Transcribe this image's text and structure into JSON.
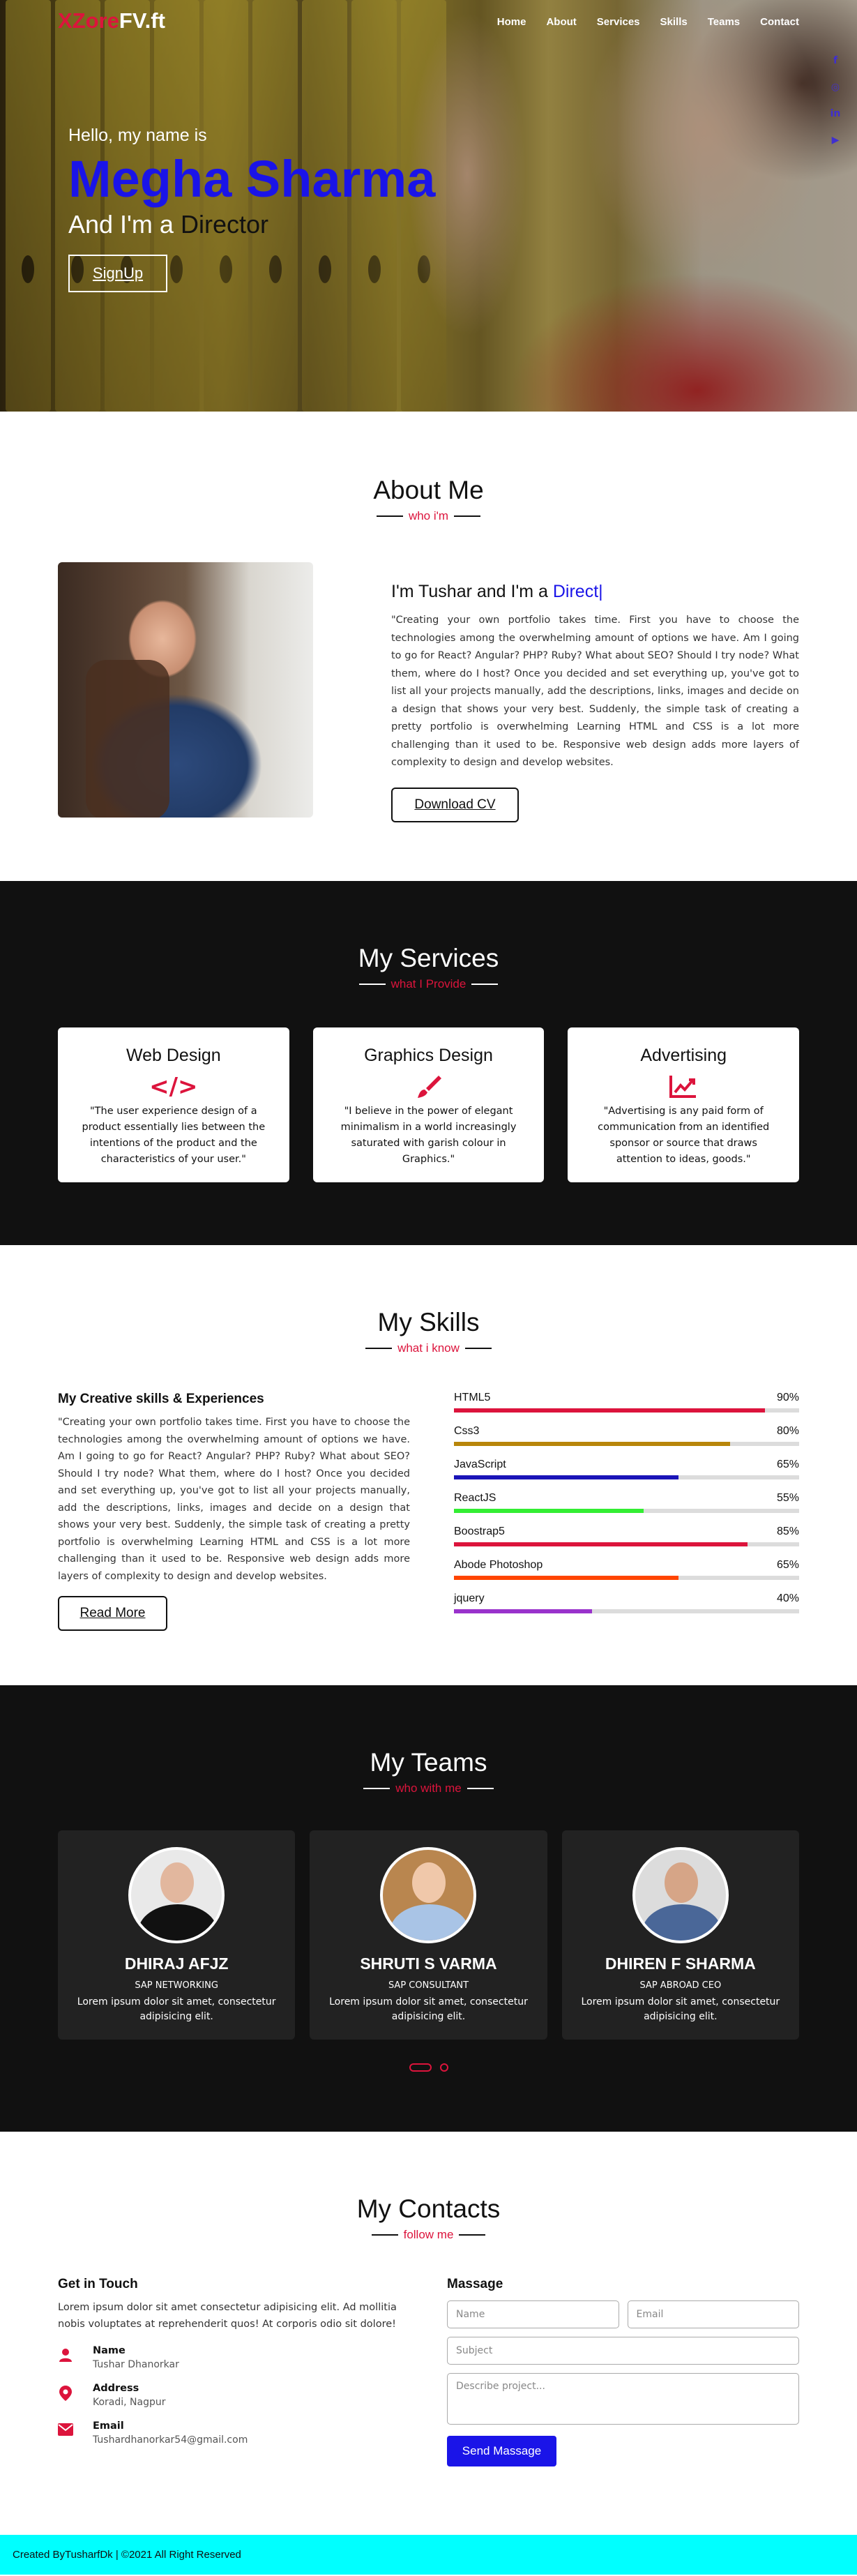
{
  "nav": {
    "logo_part1": "XZore",
    "logo_part2": "FV.ft",
    "items": [
      {
        "label": "Home"
      },
      {
        "label": "About"
      },
      {
        "label": "Services"
      },
      {
        "label": "Skills"
      },
      {
        "label": "Teams"
      },
      {
        "label": "Contact"
      }
    ]
  },
  "socials": [
    "facebook-icon",
    "instagram-icon",
    "linkedin-icon",
    "youtube-icon"
  ],
  "hero": {
    "greeting": "Hello, my name is",
    "name": "Megha Sharma",
    "role_prefix": "And I'm a ",
    "role": "Director",
    "signup_label": "SignUp"
  },
  "about": {
    "title": "About Me",
    "subtitle": "who i'm",
    "heading_prefix": "I'm Tushar and I'm a ",
    "heading_typed": "Direct|",
    "text": "\"Creating your own portfolio takes time. First you have to choose the technologies among the overwhelming amount of options we have. Am I going to go for React? Angular? PHP? Ruby? What about SEO? Should I try node? What them, where do I host? Once you decided and set everything up, you've got to list all your projects manually, add the descriptions, links, images and decide on a design that shows your very best. Suddenly, the simple task of creating a pretty portfolio is overwhelming Learning HTML and CSS is a lot more challenging than it used to be. Responsive web design adds more layers of complexity to design and develop websites.",
    "button": "Download CV"
  },
  "services": {
    "title": "My Services",
    "subtitle": "what I Provide",
    "cards": [
      {
        "title": "Web Design",
        "icon": "code-icon",
        "text": "\"The user experience design of a product essentially lies between the intentions of the product and the characteristics of your user.\""
      },
      {
        "title": "Graphics Design",
        "icon": "paint-brush-icon",
        "text": "\"I believe in the power of elegant minimalism in a world increasingly saturated with garish colour in Graphics.\""
      },
      {
        "title": "Advertising",
        "icon": "chart-line-icon",
        "text": "\"Advertising is any paid form of communication from an identified sponsor or source that draws attention to ideas, goods.\""
      }
    ]
  },
  "skills": {
    "title": "My Skills",
    "subtitle": "what i know",
    "heading": "My Creative skills & Experiences",
    "text": "\"Creating your own portfolio takes time. First you have to choose the technologies among the overwhelming amount of options we have. Am I going to go for React? Angular? PHP? Ruby? What about SEO? Should I try node? What them, where do I host? Once you decided and set everything up, you've got to list all your projects manually, add the descriptions, links, images and decide on a design that shows your very best. Suddenly, the simple task of creating a pretty portfolio is overwhelming Learning HTML and CSS is a lot more challenging than it used to be. Responsive web design adds more layers of complexity to design and develop websites.",
    "button": "Read More",
    "items": [
      {
        "name": "HTML5",
        "percent": "90%",
        "level": 0.9,
        "color": "#dc143c"
      },
      {
        "name": "Css3",
        "percent": "80%",
        "level": 0.8,
        "color": "#b8860b"
      },
      {
        "name": "JavaScript",
        "percent": "65%",
        "level": 0.65,
        "color": "#1a14b8"
      },
      {
        "name": "ReactJS",
        "percent": "55%",
        "level": 0.55,
        "color": "#33ee33"
      },
      {
        "name": "Boostrap5",
        "percent": "85%",
        "level": 0.85,
        "color": "#dc143c"
      },
      {
        "name": "Abode Photoshop",
        "percent": "65%",
        "level": 0.65,
        "color": "#ff4500"
      },
      {
        "name": "jquery",
        "percent": "40%",
        "level": 0.4,
        "color": "#9932cc"
      }
    ]
  },
  "teams": {
    "title": "My Teams",
    "subtitle": "who with me",
    "members": [
      {
        "name": "DHIRAJ AFJZ",
        "role": "SAP NETWORKING",
        "desc": "Lorem ipsum dolor sit amet, consectetur adipisicing elit."
      },
      {
        "name": "SHRUTI S VARMA",
        "role": "SAP CONSULTANT",
        "desc": "Lorem ipsum dolor sit amet, consectetur adipisicing elit."
      },
      {
        "name": "DHIREN F SHARMA",
        "role": "SAP ABROAD CEO",
        "desc": "Lorem ipsum dolor sit amet, consectetur adipisicing elit."
      }
    ]
  },
  "contacts": {
    "title": "My Contacts",
    "subtitle": "follow me",
    "left_heading": "Get in Touch",
    "left_text": "Lorem ipsum dolor sit amet consectetur adipisicing elit. Ad mollitia nobis voluptates at reprehenderit quos! At corporis odio sit dolore!",
    "info": [
      {
        "icon": "user-icon",
        "label": "Name",
        "value": "Tushar Dhanorkar"
      },
      {
        "icon": "location-pin-icon",
        "label": "Address",
        "value": "Koradi, Nagpur"
      },
      {
        "icon": "envelope-icon",
        "label": "Email",
        "value": "Tushardhanorkar54@gmail.com"
      }
    ],
    "form_heading": "Massage",
    "placeholders": {
      "name": "Name",
      "email": "Email",
      "subject": "Subject",
      "project": "Describe project..."
    },
    "send": "Send Massage"
  },
  "footer": {
    "text": "Created ByTusharfDk | ©2021 All Right Reserved"
  }
}
